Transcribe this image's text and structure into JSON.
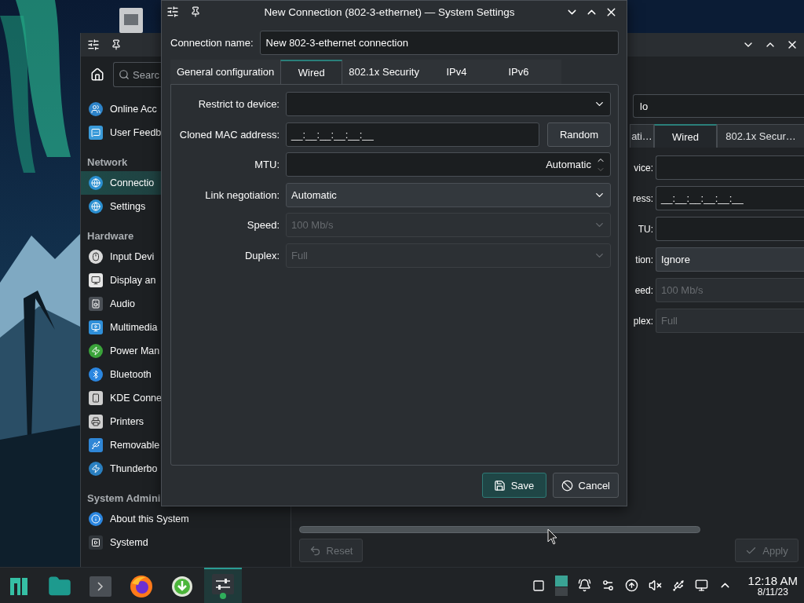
{
  "back_window": {
    "search": {
      "placeholder": "Searc"
    },
    "sidebar": {
      "sections": [
        {
          "items": [
            {
              "label": "Online Acc",
              "selected": false
            },
            {
              "label": "User Feedb",
              "selected": false
            }
          ]
        },
        {
          "header": "Network",
          "items": [
            {
              "label": "Connectio",
              "selected": true
            },
            {
              "label": "Settings",
              "selected": false
            }
          ]
        },
        {
          "header": "Hardware",
          "items": [
            {
              "label": "Input Devi",
              "selected": false
            },
            {
              "label": "Display an",
              "selected": false
            },
            {
              "label": "Audio",
              "selected": false
            },
            {
              "label": "Multimedia",
              "selected": false
            },
            {
              "label": "Power Man",
              "selected": false
            },
            {
              "label": "Bluetooth",
              "selected": false
            },
            {
              "label": "KDE Conne",
              "selected": false
            },
            {
              "label": "Printers",
              "selected": false
            },
            {
              "label": "Removable",
              "selected": false
            },
            {
              "label": "Thunderbo",
              "selected": false
            }
          ]
        },
        {
          "header": "System Admini",
          "items": [
            {
              "label": "About this System",
              "selected": false
            },
            {
              "label": "Systemd",
              "selected": false
            }
          ]
        }
      ]
    },
    "connection_field": {
      "value": "lo"
    },
    "tabs": [
      {
        "label": "ati…",
        "selected": false
      },
      {
        "label": "Wired",
        "selected": true
      },
      {
        "label": "802.1x Secur…",
        "selected": false
      }
    ],
    "rows": [
      {
        "label": "vice:",
        "kind": "input",
        "disabled": false
      },
      {
        "label": "ress:",
        "kind": "input",
        "value": "__:__:__:__:__:__",
        "disabled": false
      },
      {
        "label": "TU:",
        "kind": "input",
        "disabled": false
      },
      {
        "label": "tion:",
        "kind": "combo",
        "value": "Ignore",
        "disabled": false
      },
      {
        "label": "eed:",
        "kind": "combo",
        "value": "100 Mb/s",
        "disabled": true
      },
      {
        "label": "plex:",
        "kind": "combo",
        "value": "Full",
        "disabled": true
      }
    ],
    "buttons": [
      {
        "label": "Reset",
        "kind": "reset",
        "disabled": true
      },
      {
        "label": "Apply",
        "kind": "apply",
        "disabled": true
      }
    ]
  },
  "dialog": {
    "title": "New Connection (802-3-ethernet) — System Settings",
    "connection_name": {
      "label": "Connection name:",
      "value": "New 802-3-ethernet connection"
    },
    "tabs": [
      {
        "label": "General configuration",
        "selected": false
      },
      {
        "label": "Wired",
        "selected": true
      },
      {
        "label": "802.1x Security",
        "selected": false
      },
      {
        "label": "IPv4",
        "selected": false
      },
      {
        "label": "IPv6",
        "selected": false
      }
    ],
    "rows": [
      {
        "label": "Restrict to device:",
        "kind": "editable_combo",
        "disabled": false
      },
      {
        "label": "Cloned MAC address:",
        "kind": "mac",
        "value": "__:__:__:__:__:__",
        "button": "Random",
        "disabled": false
      },
      {
        "label": "MTU:",
        "kind": "spin",
        "value": "Automatic",
        "disabled": false
      },
      {
        "label": "Link negotiation:",
        "kind": "combo",
        "value": "Automatic",
        "disabled": false
      },
      {
        "label": "Speed:",
        "kind": "combo",
        "value": "100 Mb/s",
        "disabled": true
      },
      {
        "label": "Duplex:",
        "kind": "combo",
        "value": "Full",
        "disabled": true
      }
    ],
    "buttons": [
      {
        "label": "Save",
        "kind": "save",
        "focused": true
      },
      {
        "label": "Cancel",
        "kind": "cancel",
        "focused": false
      }
    ]
  },
  "taskbar": {
    "tasks": [
      {
        "active": false
      },
      {
        "active": false
      },
      {
        "active": false
      },
      {
        "active": false
      },
      {
        "active": false
      },
      {
        "active": true
      }
    ],
    "clock": {
      "time": "12:18 AM",
      "date": "8/11/23"
    }
  }
}
